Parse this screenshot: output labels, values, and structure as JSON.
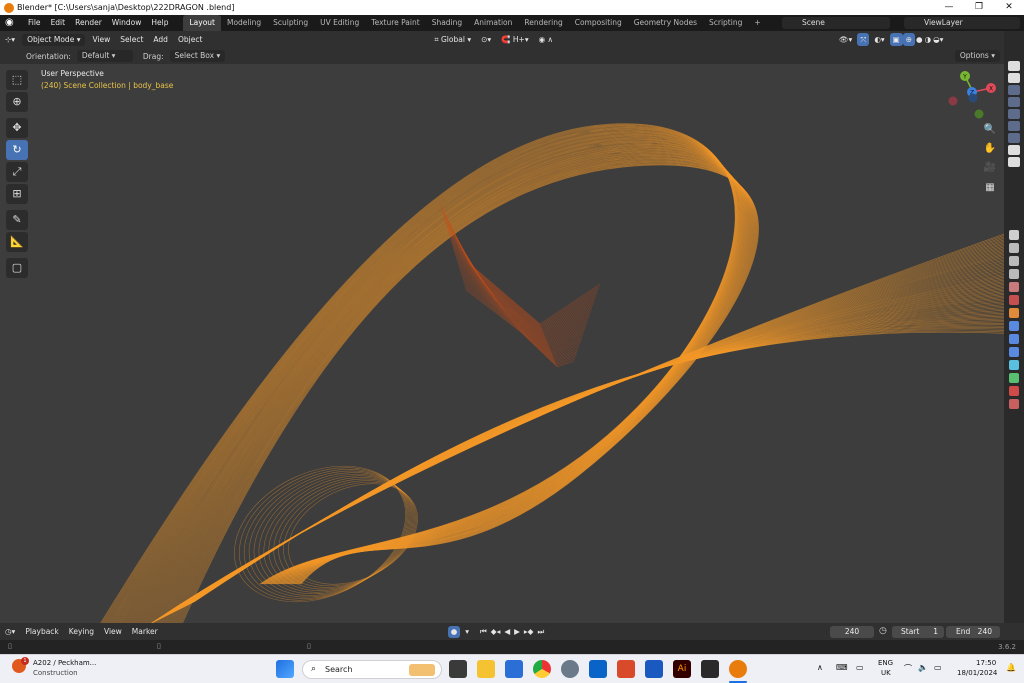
{
  "window": {
    "title": "Blender* [C:\\Users\\sanja\\Desktop\\222DRAGON .blend]",
    "minimize": "—",
    "maximize": "❐",
    "close": "✕"
  },
  "menu": [
    "File",
    "Edit",
    "Render",
    "Window",
    "Help"
  ],
  "workspaces": [
    "Layout",
    "Modeling",
    "Sculpting",
    "UV Editing",
    "Texture Paint",
    "Shading",
    "Animation",
    "Rendering",
    "Compositing",
    "Geometry Nodes",
    "Scripting"
  ],
  "add_workspace": "+",
  "scene": "Scene",
  "view_layer": "ViewLayer",
  "header": {
    "mode": "Object Mode",
    "menus": [
      "View",
      "Select",
      "Add",
      "Object"
    ],
    "transform": "Global",
    "snap_label": "H+"
  },
  "subheader": {
    "orientation_label": "Orientation:",
    "orientation_value": "Default",
    "drag_label": "Drag:",
    "drag_value": "Select Box",
    "options": "Options"
  },
  "viewport": {
    "perspective": "User Perspective",
    "collection": "(240) Scene Collection | body_base"
  },
  "gizmo": {
    "x": "X",
    "y": "Y",
    "z": "Z"
  },
  "timeline": {
    "menus": [
      "Playback",
      "Keying",
      "View",
      "Marker"
    ],
    "current_frame": "240",
    "start_label": "Start",
    "start_value": "1",
    "end_label": "End",
    "end_value": "240"
  },
  "status": {
    "version": "3.6.2"
  },
  "taskbar": {
    "notification_title": "A202 / Peckham...",
    "notification_sub": "Construction",
    "search_placeholder": "Search",
    "lang": "ENG",
    "region": "UK",
    "time": "17:50",
    "date": "18/01/2024"
  },
  "colors": {
    "wire": "#f59a2a",
    "wire_dark": "#c8501a",
    "accent": "#4772b3",
    "viewport_bg": "#3d3d3d"
  }
}
